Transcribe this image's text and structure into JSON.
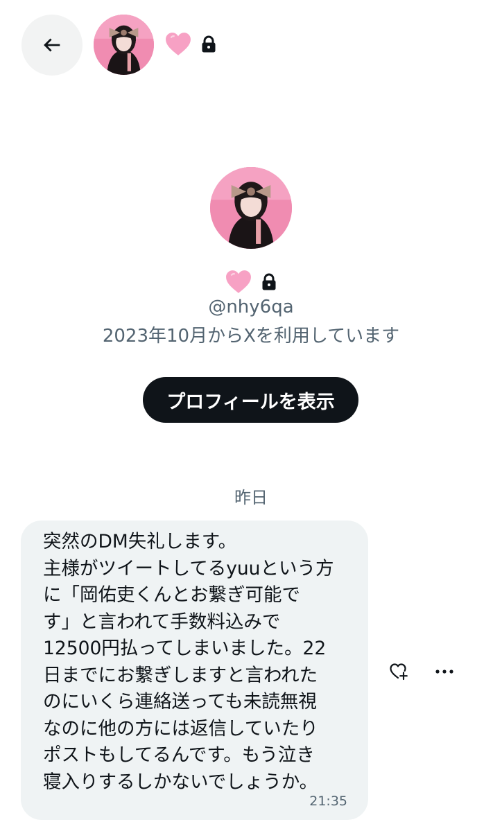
{
  "header": {
    "back_icon": "arrow-left-icon",
    "name_emoji": "pink-heart-icon",
    "lock_icon": "lock-icon"
  },
  "profile": {
    "handle": "@nhy6qa",
    "joined": "2023年10月からXを利用しています",
    "view_profile_label": "プロフィールを表示"
  },
  "conversation": {
    "date_separator": "昨日",
    "messages": [
      {
        "lines": [
          "突然のDM失礼します。",
          "主様がツイートしてるyuuという方",
          "に「岡佑吏くんとお繋ぎ可能で",
          "す」と言われて手数料込みで",
          "12500円払ってしまいました。22",
          "日までにお繋ぎしますと言われた",
          "のにいくら連絡送っても未読無視",
          "なのに他の方には返信していたり",
          "ポストもしてるんです。もう泣き",
          "寝入りするしかないでしょうか。"
        ],
        "time": "21:35"
      }
    ]
  },
  "colors": {
    "accent_pink": "#f7a1c4",
    "bubble_bg": "#eff3f4",
    "secondary_text": "#536471",
    "primary_text": "#0f1419"
  }
}
